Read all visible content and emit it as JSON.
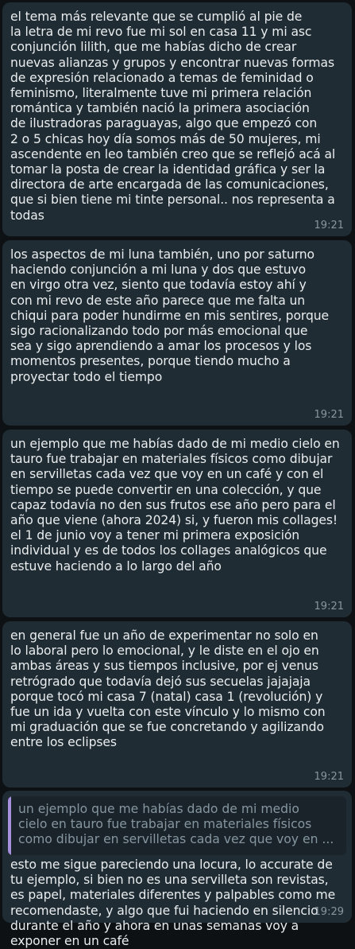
{
  "messages": [
    {
      "text": "el tema más relevante que se cumplió al pie de\nla letra de mi revo fue mi sol en casa 11 y mi asc\nconjunción lilith, que me habías dicho de crear\nnuevas alianzas y grupos y encontrar nuevas formas\nde expresión relacionado a temas de feminidad o\nfeminismo, literalmente tuve mi primera relación\nromántica y también nació la primera asociación\nde ilustradoras paraguayas, algo que empezó con\n2 o 5 chicas hoy día somos más de 50 mujeres, mi\nascendente en leo también creo que se reflejó acá al\ntomar la posta de crear la identidad gráfica y ser la\ndirectora de arte encargada de las comunicaciones,\nque si bien tiene mi tinte personal.. nos representa a\ntodas",
      "time": "19:21"
    },
    {
      "text": "los aspectos de mi luna también, uno por saturno\nhaciendo conjunción a mi luna y dos que estuvo\nen virgo otra vez, siento que todavía estoy ahí y\ncon mi revo de este año parece que me falta un\nchiqui para poder hundirme en mis sentires, porque\nsigo racionalizando todo por más emocional que\nsea y sigo aprendiendo a amar los procesos y los\nmomentos presentes, porque tiendo mucho a\nproyectar todo el tiempo",
      "time": "19:21"
    },
    {
      "text": "un ejemplo que me habías dado de mi medio cielo en\ntauro fue trabajar en materiales físicos como dibujar\nen servilletas cada vez que voy en un café y con el\ntiempo se puede convertir en una colección, y que\ncapaz todavía no den sus frutos ese año pero para el\naño que viene (ahora 2024) si, y fueron mis collages!\nel 1 de junio voy a tener mi primera exposición\nindividual y es de todos los collages analógicos que\nestuve haciendo a lo largo del año",
      "time": "19:21"
    },
    {
      "text": "en general fue un año de experimentar no solo en\nlo laboral pero lo emocional, y le diste en el ojo en\nambas áreas y sus tiempos inclusive, por ej venus\nretrógrado que todavía dejó sus secuelas jajajaja\nporque tocó mi casa 7 (natal) casa 1 (revolución) y\nfue un ida y vuelta con este vínculo y lo mismo con\nmi graduación que se fue concretando y agilizando\nentre los eclipses",
      "time": "19:21"
    }
  ],
  "reply": {
    "quote_text": "un ejemplo que me habías dado de mi medio\ncielo en tauro fue trabajar en materiales físicos\ncomo dibujar en servilletas cada vez que voy en ...",
    "quote_color": "#a791df",
    "text": "esto me sigue pareciendo una locura, lo accurate de\ntu ejemplo, si bien no es una servilleta son revistas,\nes papel, materiales diferentes y palpables como me\nrecomendaste, y algo que fui haciendo en silencio\ndurante el año y ahora en unas semanas voy a\nexponer en un café",
    "time": "19:29"
  }
}
